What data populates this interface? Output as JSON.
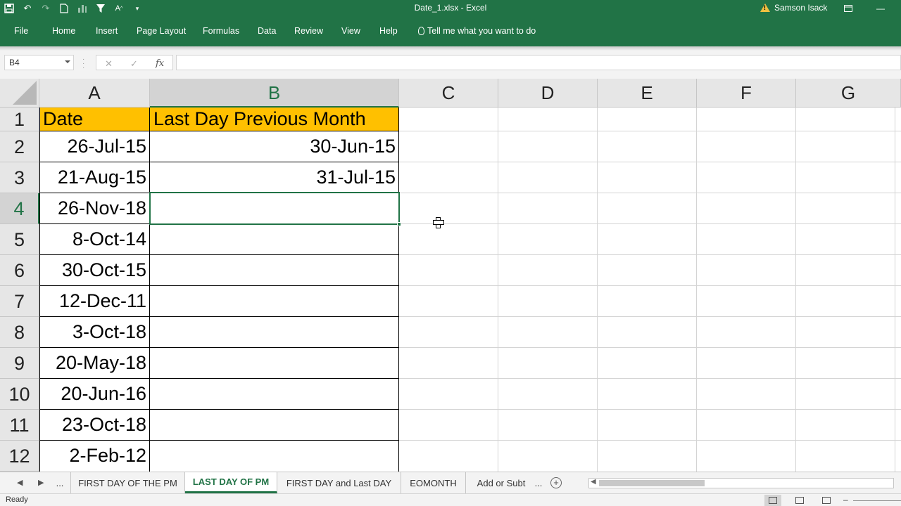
{
  "window": {
    "title": "Date_1.xlsx  -  Excel",
    "user": "Samson Isack"
  },
  "ribbon": {
    "tabs": [
      "File",
      "Home",
      "Insert",
      "Page Layout",
      "Formulas",
      "Data",
      "Review",
      "View",
      "Help"
    ],
    "tell_me": "Tell me what you want to do"
  },
  "formula_bar": {
    "name_box": "B4",
    "fx": "fx",
    "value": ""
  },
  "grid": {
    "columns": [
      "A",
      "B",
      "C",
      "D",
      "E",
      "F",
      "G"
    ],
    "selected_column": "B",
    "rows": [
      "1",
      "2",
      "3",
      "4",
      "5",
      "6",
      "7",
      "8",
      "9",
      "10",
      "11",
      "12"
    ],
    "selected_row": "4",
    "header": {
      "a": "Date",
      "b": "Last Day Previous Month"
    },
    "cells": [
      {
        "a": "26-Jul-15",
        "b": "30-Jun-15"
      },
      {
        "a": "21-Aug-15",
        "b": "31-Jul-15"
      },
      {
        "a": "26-Nov-18",
        "b": ""
      },
      {
        "a": "8-Oct-14",
        "b": ""
      },
      {
        "a": "30-Oct-15",
        "b": ""
      },
      {
        "a": "12-Dec-11",
        "b": ""
      },
      {
        "a": "3-Oct-18",
        "b": ""
      },
      {
        "a": "20-May-18",
        "b": ""
      },
      {
        "a": "20-Jun-16",
        "b": ""
      },
      {
        "a": "23-Oct-18",
        "b": ""
      },
      {
        "a": "2-Feb-12",
        "b": ""
      }
    ],
    "header_fill": "#ffc000",
    "accent": "#217346"
  },
  "sheets": {
    "more_left": "...",
    "tabs": [
      "FIRST DAY OF THE PM",
      "LAST DAY OF PM",
      "FIRST DAY and Last DAY",
      "EOMONTH",
      "Add or Subt"
    ],
    "active": "LAST DAY OF PM",
    "more_right": "..."
  },
  "status": {
    "text": "Ready"
  }
}
